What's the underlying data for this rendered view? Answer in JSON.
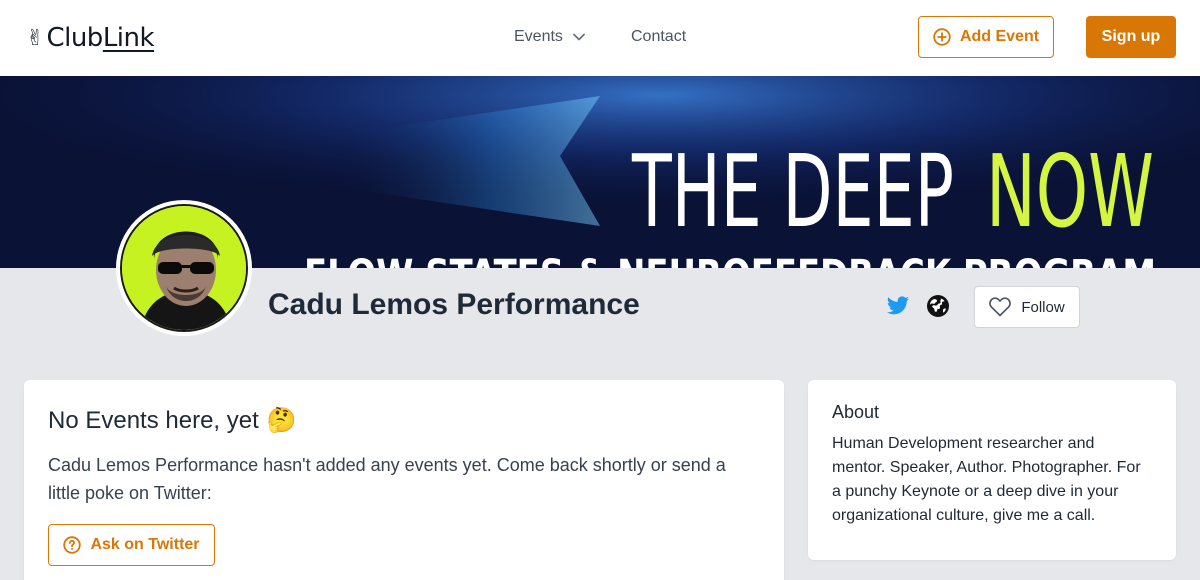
{
  "header": {
    "logo_hand": "✌",
    "logo_club": "Club",
    "logo_link": "Link",
    "nav_events": "Events",
    "nav_contact": "Contact",
    "add_event_label": "Add Event",
    "signup_label": "Sign up"
  },
  "banner": {
    "line1_a": "THE DEEP",
    "line1_b": "NOW",
    "line2": "FLOW STATES & NEUROFEEDBACK PROGRAM"
  },
  "profile": {
    "name": "Cadu Lemos Performance",
    "follow_label": "Follow"
  },
  "main": {
    "title": "No Events here, yet",
    "title_emoji": "🤔",
    "text": "Cadu Lemos Performance hasn't added any events yet. Come back shortly or send a little poke on Twitter:",
    "ask_label": "Ask on Twitter"
  },
  "about": {
    "title": "About",
    "text": "Human Development researcher and mentor. Speaker, Author. Photographer. For a punchy Keynote or a deep dive in your organizational culture, give me a call."
  },
  "colors": {
    "accent": "#d97706",
    "banner_bg": "#0a1236",
    "neon": "#d4f542",
    "twitter": "#1d9bf0"
  }
}
